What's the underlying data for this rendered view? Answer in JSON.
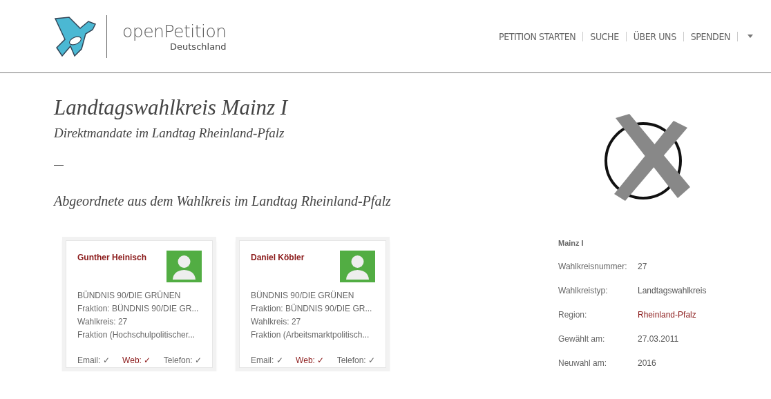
{
  "header": {
    "logo": {
      "name": "openPetition",
      "subtitle": "Deutschland"
    },
    "nav": [
      {
        "label": "PETITION STARTEN"
      },
      {
        "label": "SUCHE"
      },
      {
        "label": "ÜBER UNS"
      },
      {
        "label": "SPENDEN"
      }
    ]
  },
  "title": "Landtagswahlkreis Mainz I",
  "subtitle": "Direktmandate im Landtag Rheinland-Pfalz",
  "separator": "—",
  "section_title": "Abgeordnete aus dem Wahlkreis im Landtag Rheinland-Pfalz",
  "representatives": [
    {
      "name": "Gunther Heinisch",
      "lines": [
        "BÜNDNIS 90/DIE GRÜNEN",
        "Fraktion: BÜNDNIS 90/DIE GR...",
        "Wahlkreis: 27",
        "Fraktion (Hochschulpolitischer..."
      ],
      "contacts": [
        {
          "label": "Email: ✓",
          "kind": "text"
        },
        {
          "label": "Web: ✓",
          "kind": "link"
        },
        {
          "label": "Telefon: ✓",
          "kind": "text"
        }
      ]
    },
    {
      "name": "Daniel Köbler",
      "lines": [
        "BÜNDNIS 90/DIE GRÜNEN",
        "Fraktion: BÜNDNIS 90/DIE GR...",
        "Wahlkreis: 27",
        "Fraktion (Arbeitsmarktpolitisch..."
      ],
      "contacts": [
        {
          "label": "Email: ✓",
          "kind": "text"
        },
        {
          "label": "Web: ✓",
          "kind": "link"
        },
        {
          "label": "Telefon: ✓",
          "kind": "text"
        }
      ]
    }
  ],
  "info": {
    "heading": "Mainz I",
    "rows": [
      {
        "label": "Wahlkreisnummer:",
        "value": "27",
        "kind": "text"
      },
      {
        "label": "Wahlkreistyp:",
        "value": "Landtagswahlkreis",
        "kind": "text"
      },
      {
        "label": "Region:",
        "value": "Rheinland-Pfalz",
        "kind": "link"
      },
      {
        "label": "Gewählt am:",
        "value": "27.03.2011",
        "kind": "text"
      },
      {
        "label": "Neuwahl am:",
        "value": "2016",
        "kind": "text"
      }
    ]
  }
}
